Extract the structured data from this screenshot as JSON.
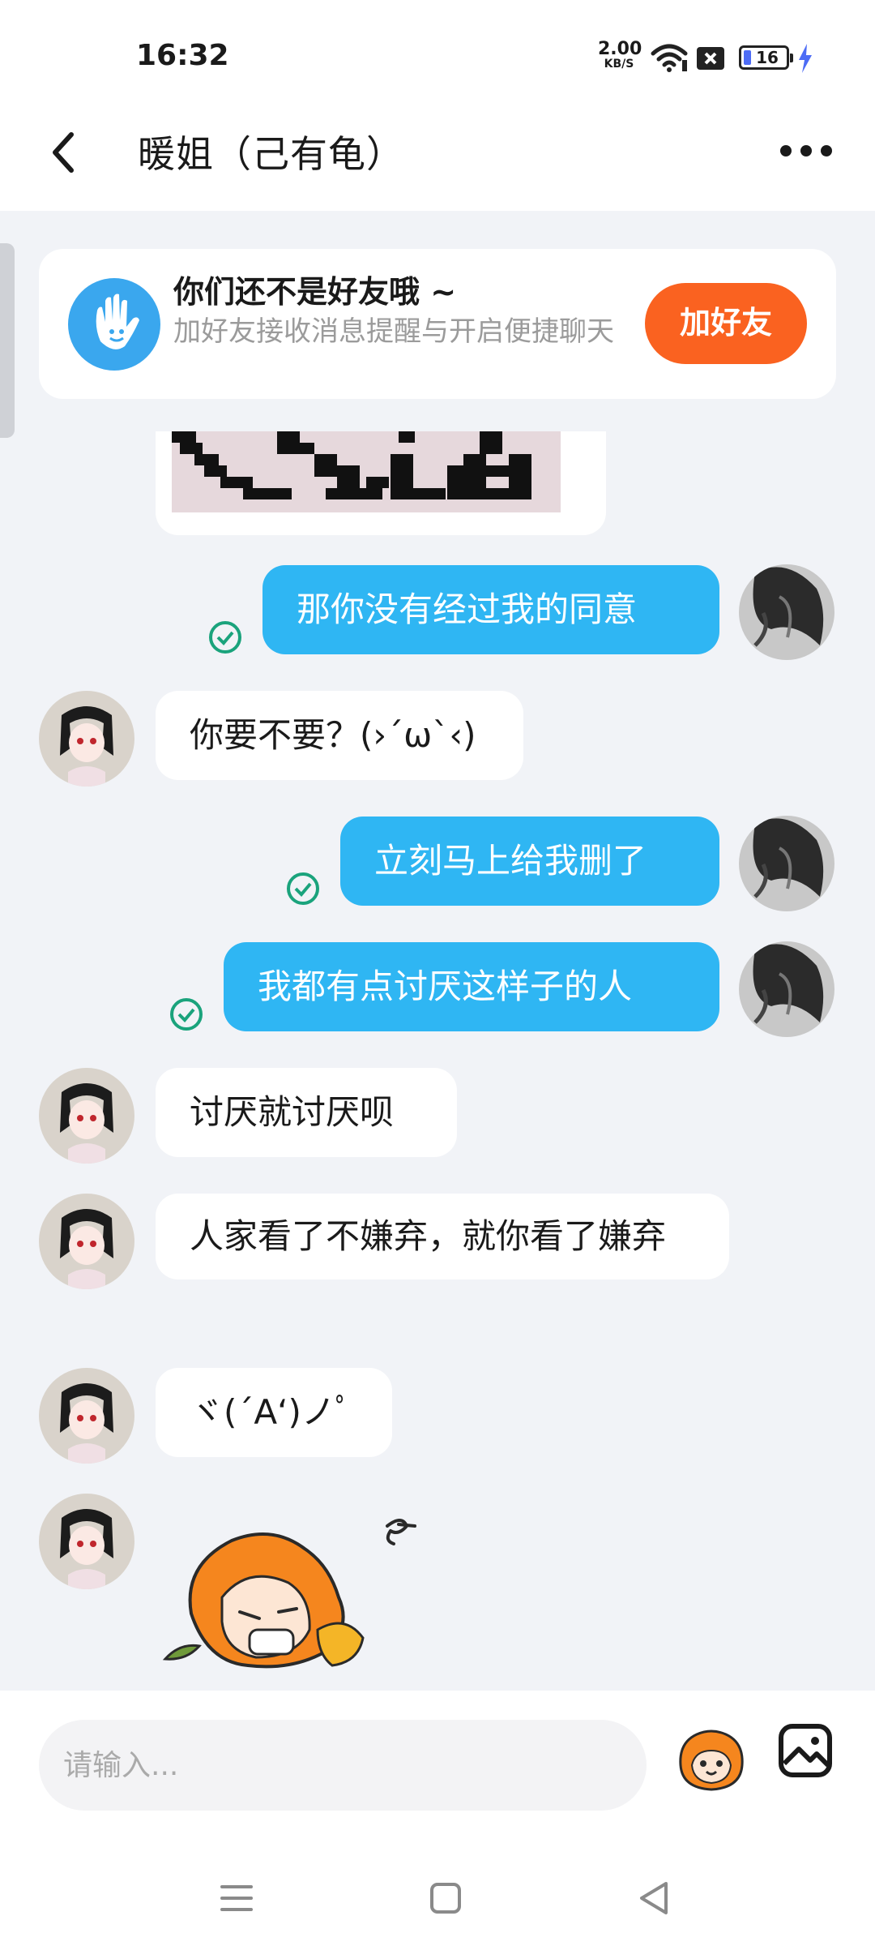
{
  "status": {
    "time": "16:32",
    "speed_value": "2.00",
    "speed_unit": "KB/S",
    "battery": "16"
  },
  "header": {
    "title": "暖姐（己有龟）"
  },
  "friend_card": {
    "title": "你们还不是好友哦 ~",
    "subtitle": "加好友接收消息提醒与开启便捷聊天",
    "button": "加好友"
  },
  "messages": [
    {
      "side": "me",
      "text": "那你没有经过我的同意"
    },
    {
      "side": "them",
      "text": "你要不要？(›´ω`‹)"
    },
    {
      "side": "me",
      "text": "立刻马上给我删了"
    },
    {
      "side": "me",
      "text": "我都有点讨厌这样子的人"
    },
    {
      "side": "them",
      "text": "讨厌就讨厌呗"
    },
    {
      "side": "them",
      "text": "人家看了不嫌弃，就你看了嫌弃"
    },
    {
      "side": "them",
      "text": "ヾ(´A‘)ノﾟ"
    }
  ],
  "input": {
    "placeholder": "请输入..."
  },
  "colors": {
    "accent": "#2fb6f3",
    "add_button": "#fa6220",
    "check": "#1aa37c"
  },
  "icons": {
    "back": "chevron-left-icon",
    "more": "more-dots-icon",
    "face": "emoji-icon",
    "image": "image-icon"
  }
}
